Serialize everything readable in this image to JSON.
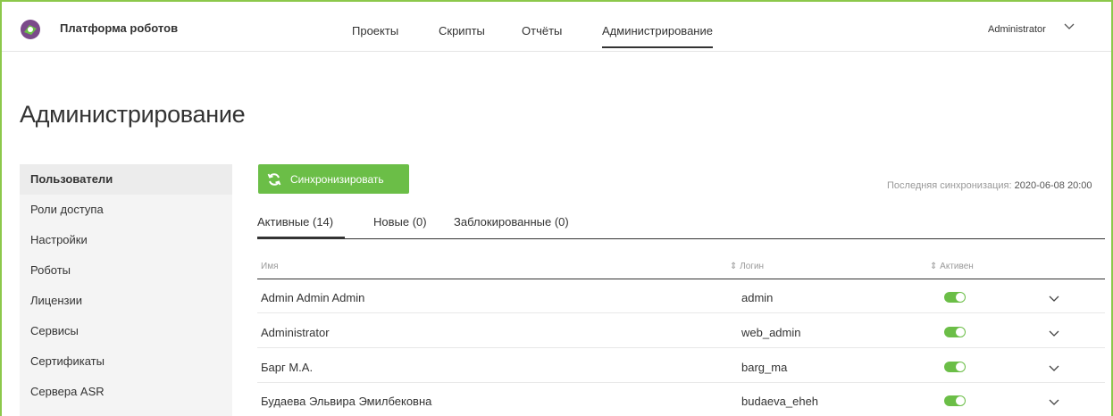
{
  "app": {
    "title": "Платформа роботов",
    "logo_icon": "robot-logo-icon"
  },
  "nav": {
    "items": [
      {
        "label": "Проекты",
        "active": false
      },
      {
        "label": "Скрипты",
        "active": false
      },
      {
        "label": "Отчёты",
        "active": false
      },
      {
        "label": "Администрирование",
        "active": true
      }
    ]
  },
  "user": {
    "name": "Administrator"
  },
  "page": {
    "title": "Администрирование"
  },
  "sidebar": {
    "items": [
      {
        "label": "Пользователи",
        "active": true
      },
      {
        "label": "Роли доступа"
      },
      {
        "label": "Настройки"
      },
      {
        "label": "Роботы"
      },
      {
        "label": "Лицензии"
      },
      {
        "label": "Сервисы"
      },
      {
        "label": "Сертификаты"
      },
      {
        "label": "Сервера ASR"
      }
    ]
  },
  "sync": {
    "button_label": "Синхронизировать",
    "last_label": "Последняя синхронизация:",
    "last_value": "2020-06-08 20:00"
  },
  "tabs": [
    {
      "label": "Активные (14)",
      "active": true
    },
    {
      "label": "Новые (0)"
    },
    {
      "label": "Заблокированные (0)"
    }
  ],
  "table": {
    "columns": {
      "name": "Имя",
      "login": "Логин",
      "active": "Активен"
    },
    "rows": [
      {
        "name": "Admin Admin Admin",
        "login": "admin",
        "active": true
      },
      {
        "name": "Administrator",
        "login": "web_admin",
        "active": true
      },
      {
        "name": "Барг М.А.",
        "login": "barg_ma",
        "active": true
      },
      {
        "name": "Будаева Эльвира Эмилбековна",
        "login": "budaeva_eheh",
        "active": true
      }
    ]
  },
  "colors": {
    "accent": "#6bbe47",
    "frame": "#8cc84b"
  }
}
